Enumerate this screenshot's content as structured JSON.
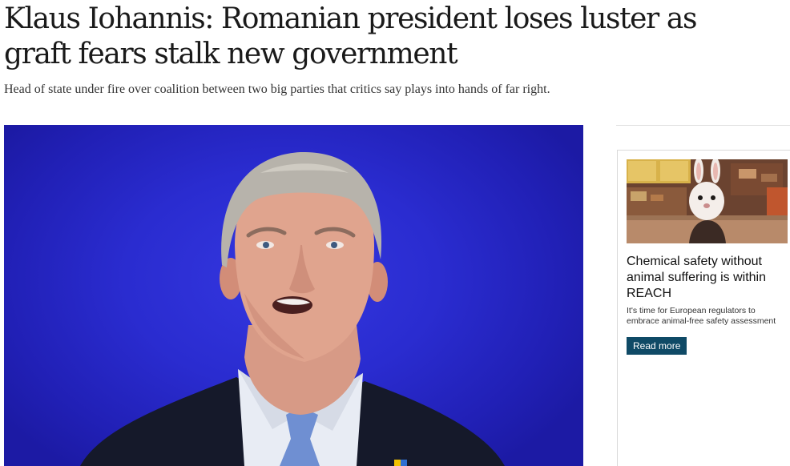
{
  "article": {
    "headline": "Klaus Iohannis: Romanian president loses luster as graft fears stalk new government",
    "standfirst": "Head of state under fire over coalition between two big parties that critics say plays into hands of far right."
  },
  "colors": {
    "hero_background": "#2a2cd0",
    "ad_button": "#0f4a66"
  },
  "sidebar": {
    "ad": {
      "title": "Chemical safety without animal suffering is within REACH",
      "description": "It's time for European regulators to embrace animal-free safety assessment",
      "button_label": "Read more"
    }
  }
}
